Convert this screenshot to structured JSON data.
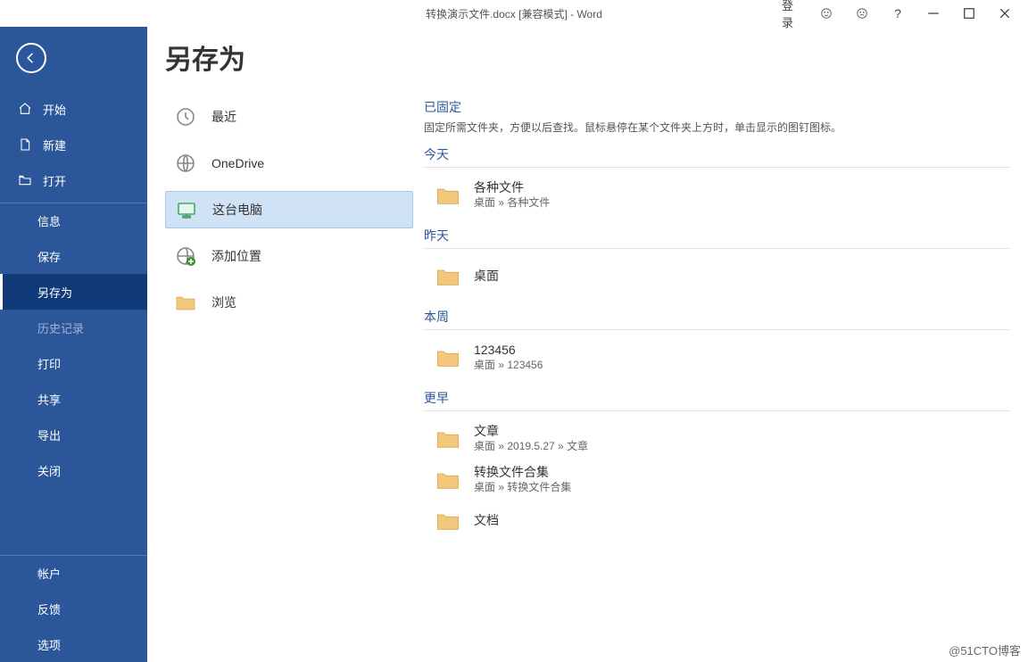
{
  "titlebar": {
    "title": "转换演示文件.docx [兼容模式] - Word",
    "login_label": "登录"
  },
  "page_title": "另存为",
  "sidebar": {
    "items": [
      {
        "label": "开始",
        "icon": "home",
        "indent": false
      },
      {
        "label": "新建",
        "icon": "new-doc",
        "indent": false
      },
      {
        "label": "打开",
        "icon": "open-folder",
        "indent": false
      },
      {
        "label": "信息",
        "indent": true,
        "sep_top": true
      },
      {
        "label": "保存",
        "indent": true
      },
      {
        "label": "另存为",
        "indent": true,
        "selected": true
      },
      {
        "label": "历史记录",
        "indent": true,
        "disabled": true
      },
      {
        "label": "打印",
        "indent": true
      },
      {
        "label": "共享",
        "indent": true
      },
      {
        "label": "导出",
        "indent": true
      },
      {
        "label": "关闭",
        "indent": true
      }
    ],
    "bottom_items": [
      {
        "label": "帐户"
      },
      {
        "label": "反馈"
      },
      {
        "label": "选项"
      }
    ]
  },
  "locations": [
    {
      "label": "最近",
      "icon": "clock"
    },
    {
      "label": "OneDrive",
      "icon": "globe"
    },
    {
      "label": "这台电脑",
      "icon": "pc",
      "selected": true
    },
    {
      "label": "添加位置",
      "icon": "globe-plus"
    },
    {
      "label": "浏览",
      "icon": "folder"
    }
  ],
  "pinned": {
    "header": "已固定",
    "hint": "固定所需文件夹，方便以后查找。鼠标悬停在某个文件夹上方时，单击显示的图钉图标。"
  },
  "sections": [
    {
      "header": "今天",
      "items": [
        {
          "title": "各种文件",
          "path": "桌面 » 各种文件"
        }
      ]
    },
    {
      "header": "昨天",
      "items": [
        {
          "title": "桌面",
          "path": ""
        }
      ]
    },
    {
      "header": "本周",
      "items": [
        {
          "title": "123456",
          "path": "桌面 » 123456"
        }
      ]
    },
    {
      "header": "更早",
      "items": [
        {
          "title": "文章",
          "path": "桌面 » 2019.5.27 » 文章"
        },
        {
          "title": "转换文件合集",
          "path": "桌面 » 转换文件合集"
        },
        {
          "title": "文档",
          "path": ""
        }
      ]
    }
  ],
  "watermark": "@51CTO博客"
}
